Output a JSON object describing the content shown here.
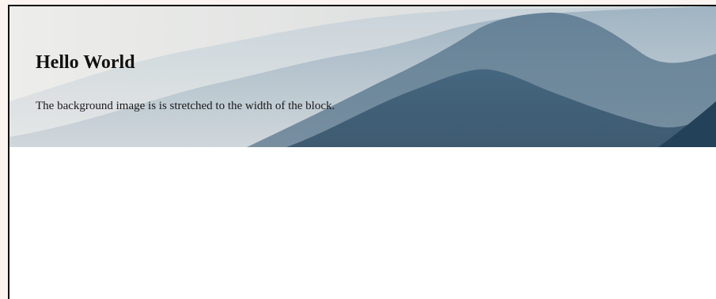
{
  "hero": {
    "title": "Hello World",
    "description": "The background image is is stretched to the width of the block.",
    "background_image": "misty-mountains",
    "colors": {
      "sky": "#e3e3e1",
      "far_ridge": "#b9c7d0",
      "mid_ridge": "#8fa6b6",
      "near_ridge": "#56748b",
      "front_ridge": "#2f5570"
    }
  }
}
